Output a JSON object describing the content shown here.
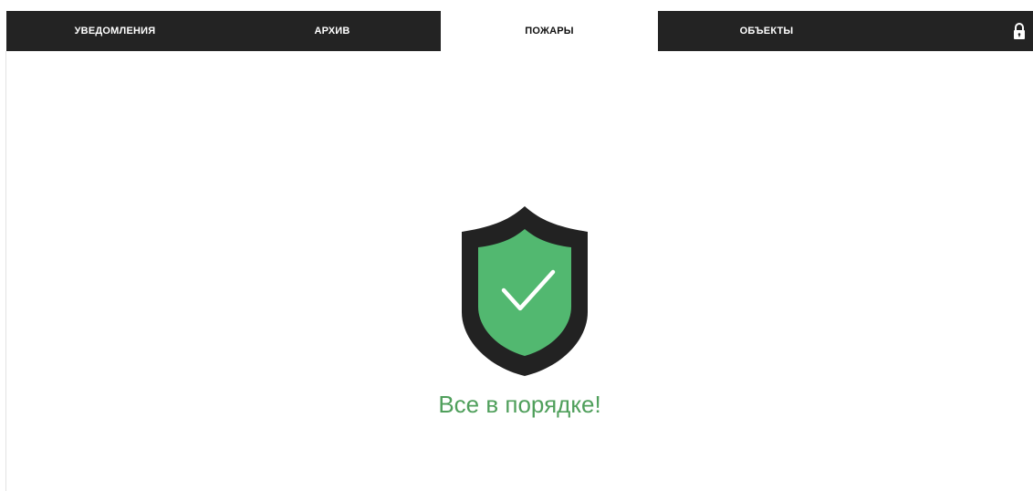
{
  "nav": {
    "tabs": [
      {
        "label": "УВЕДОМЛЕНИЯ",
        "active": false
      },
      {
        "label": "АРХИВ",
        "active": false
      },
      {
        "label": "ПОЖАРЫ",
        "active": true
      },
      {
        "label": "ОБЪЕКТЫ",
        "active": false
      }
    ],
    "lock_icon": "lock-icon"
  },
  "main": {
    "status_text": "Все в порядке!",
    "shield_icon": "shield-check-icon"
  },
  "colors": {
    "nav_bg": "#232323",
    "active_tab_bg": "#ffffff",
    "shield_outer": "#222222",
    "shield_inner": "#52b870",
    "status_text": "#4f9f5b"
  }
}
